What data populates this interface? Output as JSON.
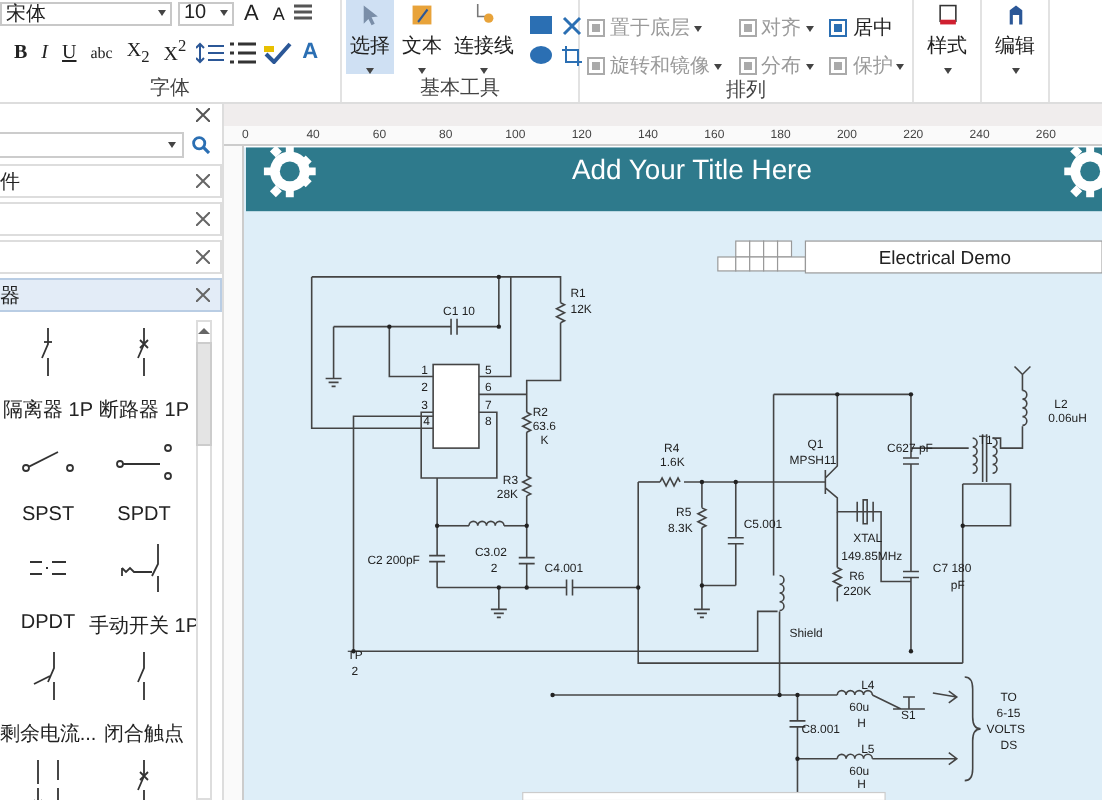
{
  "ribbon": {
    "font_name": "宋体",
    "font_size": "10",
    "size_buttons": [
      "A",
      "A"
    ],
    "format_buttons": [
      "B",
      "I",
      "U",
      "abc",
      "X$_{2}$",
      "X$^{2}$"
    ],
    "font_color_button": "A",
    "tools": [
      {
        "label": "选择",
        "selected": true
      },
      {
        "label": "文本",
        "selected": false
      },
      {
        "label": "连接线",
        "selected": false
      }
    ],
    "arrange": [
      {
        "label": "置于底层",
        "disabled": true,
        "dropdown": true
      },
      {
        "label": "对齐",
        "disabled": true,
        "dropdown": true
      },
      {
        "label": "居中",
        "disabled": false,
        "dropdown": false
      },
      {
        "label": "旋转和镜像",
        "disabled": true,
        "dropdown": true
      },
      {
        "label": "分布",
        "disabled": true,
        "dropdown": true
      },
      {
        "label": "保护",
        "disabled": true,
        "dropdown": true
      }
    ],
    "side_buttons": [
      "样式",
      "编辑"
    ],
    "groups": [
      "字体",
      "基本工具",
      "排列"
    ]
  },
  "library": {
    "categories": [
      {
        "title": "件",
        "expanded": false
      },
      {
        "expanded": false
      },
      {
        "expanded": false
      },
      {
        "title": "器",
        "expanded": true
      }
    ],
    "shapes": [
      {
        "kind": "isolator",
        "label": "隔离器 1P"
      },
      {
        "kind": "breaker",
        "label": "断路器 1P"
      },
      {
        "kind": "spst",
        "label": "SPST"
      },
      {
        "kind": "spdt",
        "label": "SPDT"
      },
      {
        "kind": "dpdt",
        "label": "DPDT"
      },
      {
        "kind": "manual",
        "label": "手动开关 1P"
      },
      {
        "kind": "rcd",
        "label": "剩余电流..."
      },
      {
        "kind": "closed",
        "label": "闭合触点"
      },
      {
        "kind": "double"
      },
      {
        "kind": "breaker"
      }
    ]
  },
  "ruler": {
    "ticks": [
      "0",
      "40",
      "60",
      "80",
      "100",
      "120",
      "140",
      "160",
      "180",
      "200",
      "220",
      "240",
      "260"
    ]
  },
  "canvas": {
    "title": "Add Your Title Here",
    "title_block": "Electrical Demo",
    "labels": [
      "C1 10",
      "R1",
      "12K",
      "1",
      "2",
      "3",
      "4",
      "5",
      "6",
      "7",
      "8",
      "R2",
      "63.6",
      "K",
      "R3",
      "28K",
      "C2 200pF",
      "C3.02",
      "2",
      "C4.001",
      "R4",
      "1.6K",
      "R5",
      "8.3K",
      "C5.001",
      "Q1",
      "MPSH11",
      "C627 pF",
      "XTAL",
      "149.85MHz",
      "R6",
      "220K",
      "C7 180",
      "pF",
      "L2",
      "0.06uH",
      "T1",
      "Shield",
      "TP",
      "2",
      "L4",
      "60u",
      "H",
      "S1",
      "C8.001",
      "L5",
      "60u",
      "H",
      "TO",
      "6-15",
      "VOLTS",
      "DS"
    ]
  }
}
